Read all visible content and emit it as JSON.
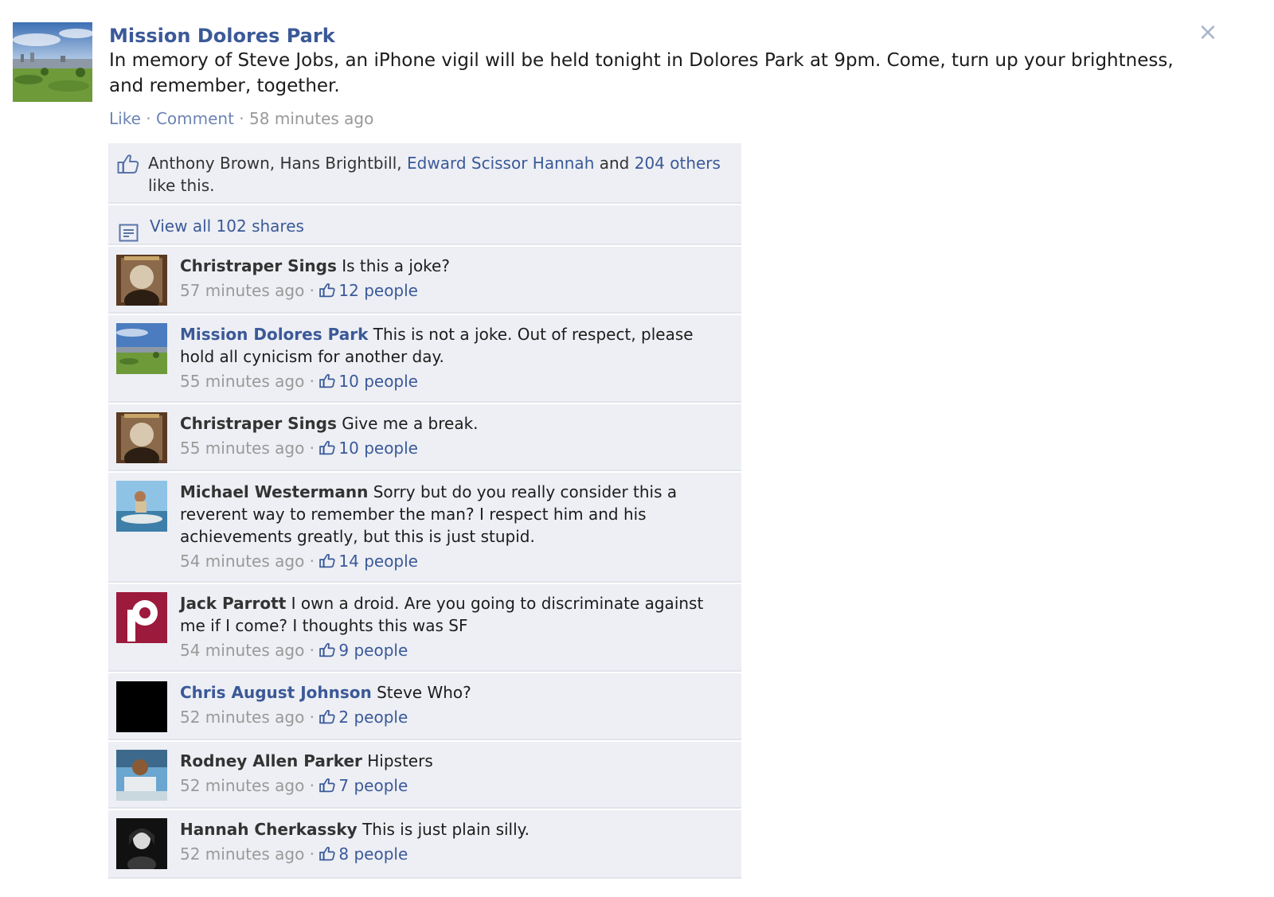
{
  "post": {
    "author": "Mission Dolores Park",
    "text": "In memory of Steve Jobs, an iPhone vigil will be held tonight in Dolores Park at 9pm. Come, turn up your brightness, and remember, together.",
    "actions": {
      "like": "Like",
      "sep1": " · ",
      "comment": "Comment",
      "sep2": " · ",
      "time": "58 minutes ago"
    },
    "close": "×"
  },
  "likes": {
    "plain_names": "Anthony Brown, Hans Brightbill, ",
    "linked_name": "Edward Scissor Hannah",
    "and_text": " and ",
    "others": "204 others",
    "suffix": " like this."
  },
  "shares": {
    "label": "View all 102 shares"
  },
  "comments": [
    {
      "name": "Christraper Sings",
      "text": "Is this a joke?",
      "time": "57 minutes ago",
      "likes": "12 people"
    },
    {
      "name": "Mission Dolores Park",
      "text": "This is not a joke. Out of respect, please hold all cynicism for another day.",
      "time": "55 minutes ago",
      "likes": "10 people"
    },
    {
      "name": "Christraper Sings",
      "text": "Give me a break.",
      "time": "55 minutes ago",
      "likes": "10 people"
    },
    {
      "name": "Michael Westermann",
      "text": "Sorry but do you really consider this a reverent way to remember the man? I respect him and his achievements greatly, but this is just stupid.",
      "time": "54 minutes ago",
      "likes": "14 people"
    },
    {
      "name": "Jack Parrott",
      "text": "I own a droid. Are you going to discriminate against me if I come? I thoughts this was SF",
      "time": "54 minutes ago",
      "likes": "9 people"
    },
    {
      "name": "Chris August Johnson",
      "text": "Steve Who?",
      "time": "52 minutes ago",
      "likes": "2 people"
    },
    {
      "name": "Rodney Allen Parker",
      "text": "Hipsters",
      "time": "52 minutes ago",
      "likes": "7 people"
    },
    {
      "name": "Hannah Cherkassky",
      "text": "This is just plain silly.",
      "time": "52 minutes ago",
      "likes": "8 people"
    }
  ],
  "meta_sep": " · ",
  "colors": {
    "link": "#3b5998",
    "ufi_bg": "#edeff4",
    "meta": "#999999"
  },
  "icons": {
    "close": "close-icon",
    "like": "thumbs-up-icon",
    "share": "share-icon"
  }
}
